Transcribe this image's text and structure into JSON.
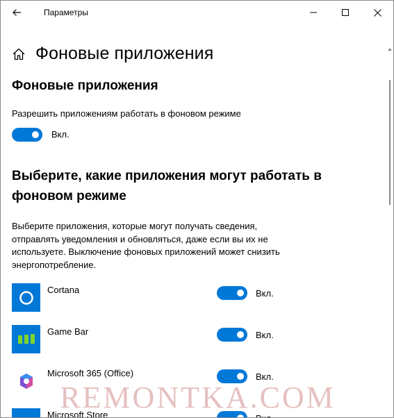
{
  "window": {
    "title": "Параметры",
    "controls": {
      "minimize": "minimize-icon",
      "maximize": "maximize-icon",
      "close": "close-icon"
    }
  },
  "page": {
    "title": "Фоновые приложения",
    "section_title": "Фоновые приложения",
    "allow_label": "Разрешить приложениям работать в фоновом режиме",
    "allow_toggle_state": "Вкл.",
    "choose_heading": "Выберите, какие приложения могут работать в фоновом режиме",
    "description": "Выберите приложения, которые могут получать сведения, отправлять уведомления и обновляться, даже если вы их не используете. Выключение фоновых приложений может снизить энергопотребление."
  },
  "apps": [
    {
      "name": "Cortana",
      "state": "Вкл.",
      "icon": "cortana-icon"
    },
    {
      "name": "Game Bar",
      "state": "Вкл.",
      "icon": "game-bar-icon"
    },
    {
      "name": "Microsoft 365 (Office)",
      "state": "Вкл.",
      "icon": "office-icon"
    },
    {
      "name": "Microsoft Store",
      "state": "Вкл.",
      "icon": "store-icon"
    }
  ],
  "colors": {
    "accent": "#0078d7",
    "toggle_knob": "#ffffff",
    "text": "#000000"
  },
  "watermark": "REMONTKA.COM"
}
